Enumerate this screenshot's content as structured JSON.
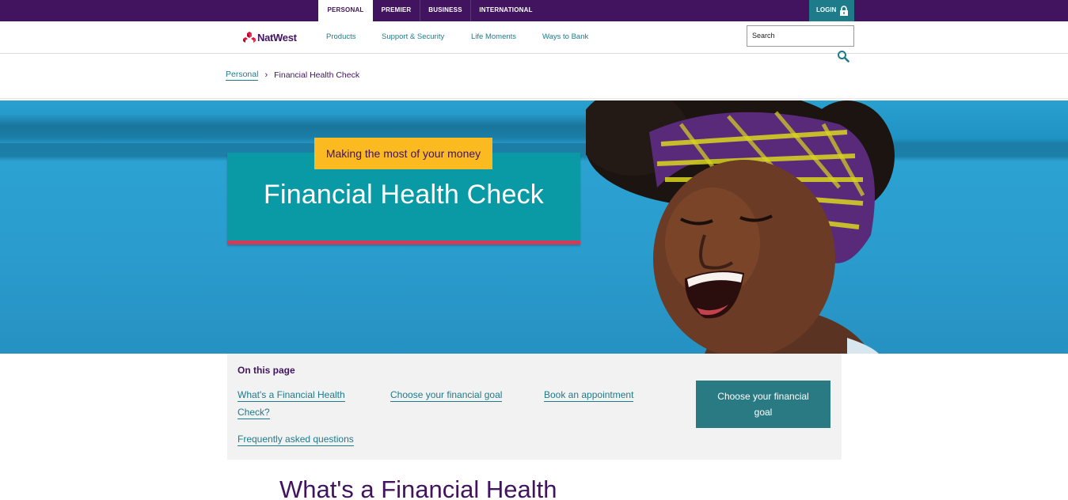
{
  "topbar": {
    "tabs": [
      "PERSONAL",
      "PREMIER",
      "BUSINESS",
      "INTERNATIONAL"
    ],
    "login": "LOGIN"
  },
  "nav": {
    "brand": "NatWest",
    "links": [
      "Products",
      "Support & Security",
      "Life Moments",
      "Ways to Bank"
    ],
    "search_value": "Search"
  },
  "breadcrumb": {
    "home": "Personal",
    "current": "Financial Health Check"
  },
  "hero": {
    "tag": "Making the most of your money",
    "title": "Financial Health Check"
  },
  "on_this_page": {
    "heading": "On this page",
    "links": [
      "What's a Financial Health",
      "Check?",
      "Choose your financial goal",
      "Book an appointment",
      "Frequently asked questions"
    ],
    "cta": [
      "Choose your financial",
      "goal"
    ]
  },
  "section": {
    "heading": "What's a Financial Health"
  },
  "colors": {
    "brand_purple": "#42145f",
    "teal": "#1d7b8a",
    "title_box": "#0a9aa5",
    "tag_yellow": "#fbba20",
    "accent_red": "#d33a57"
  }
}
